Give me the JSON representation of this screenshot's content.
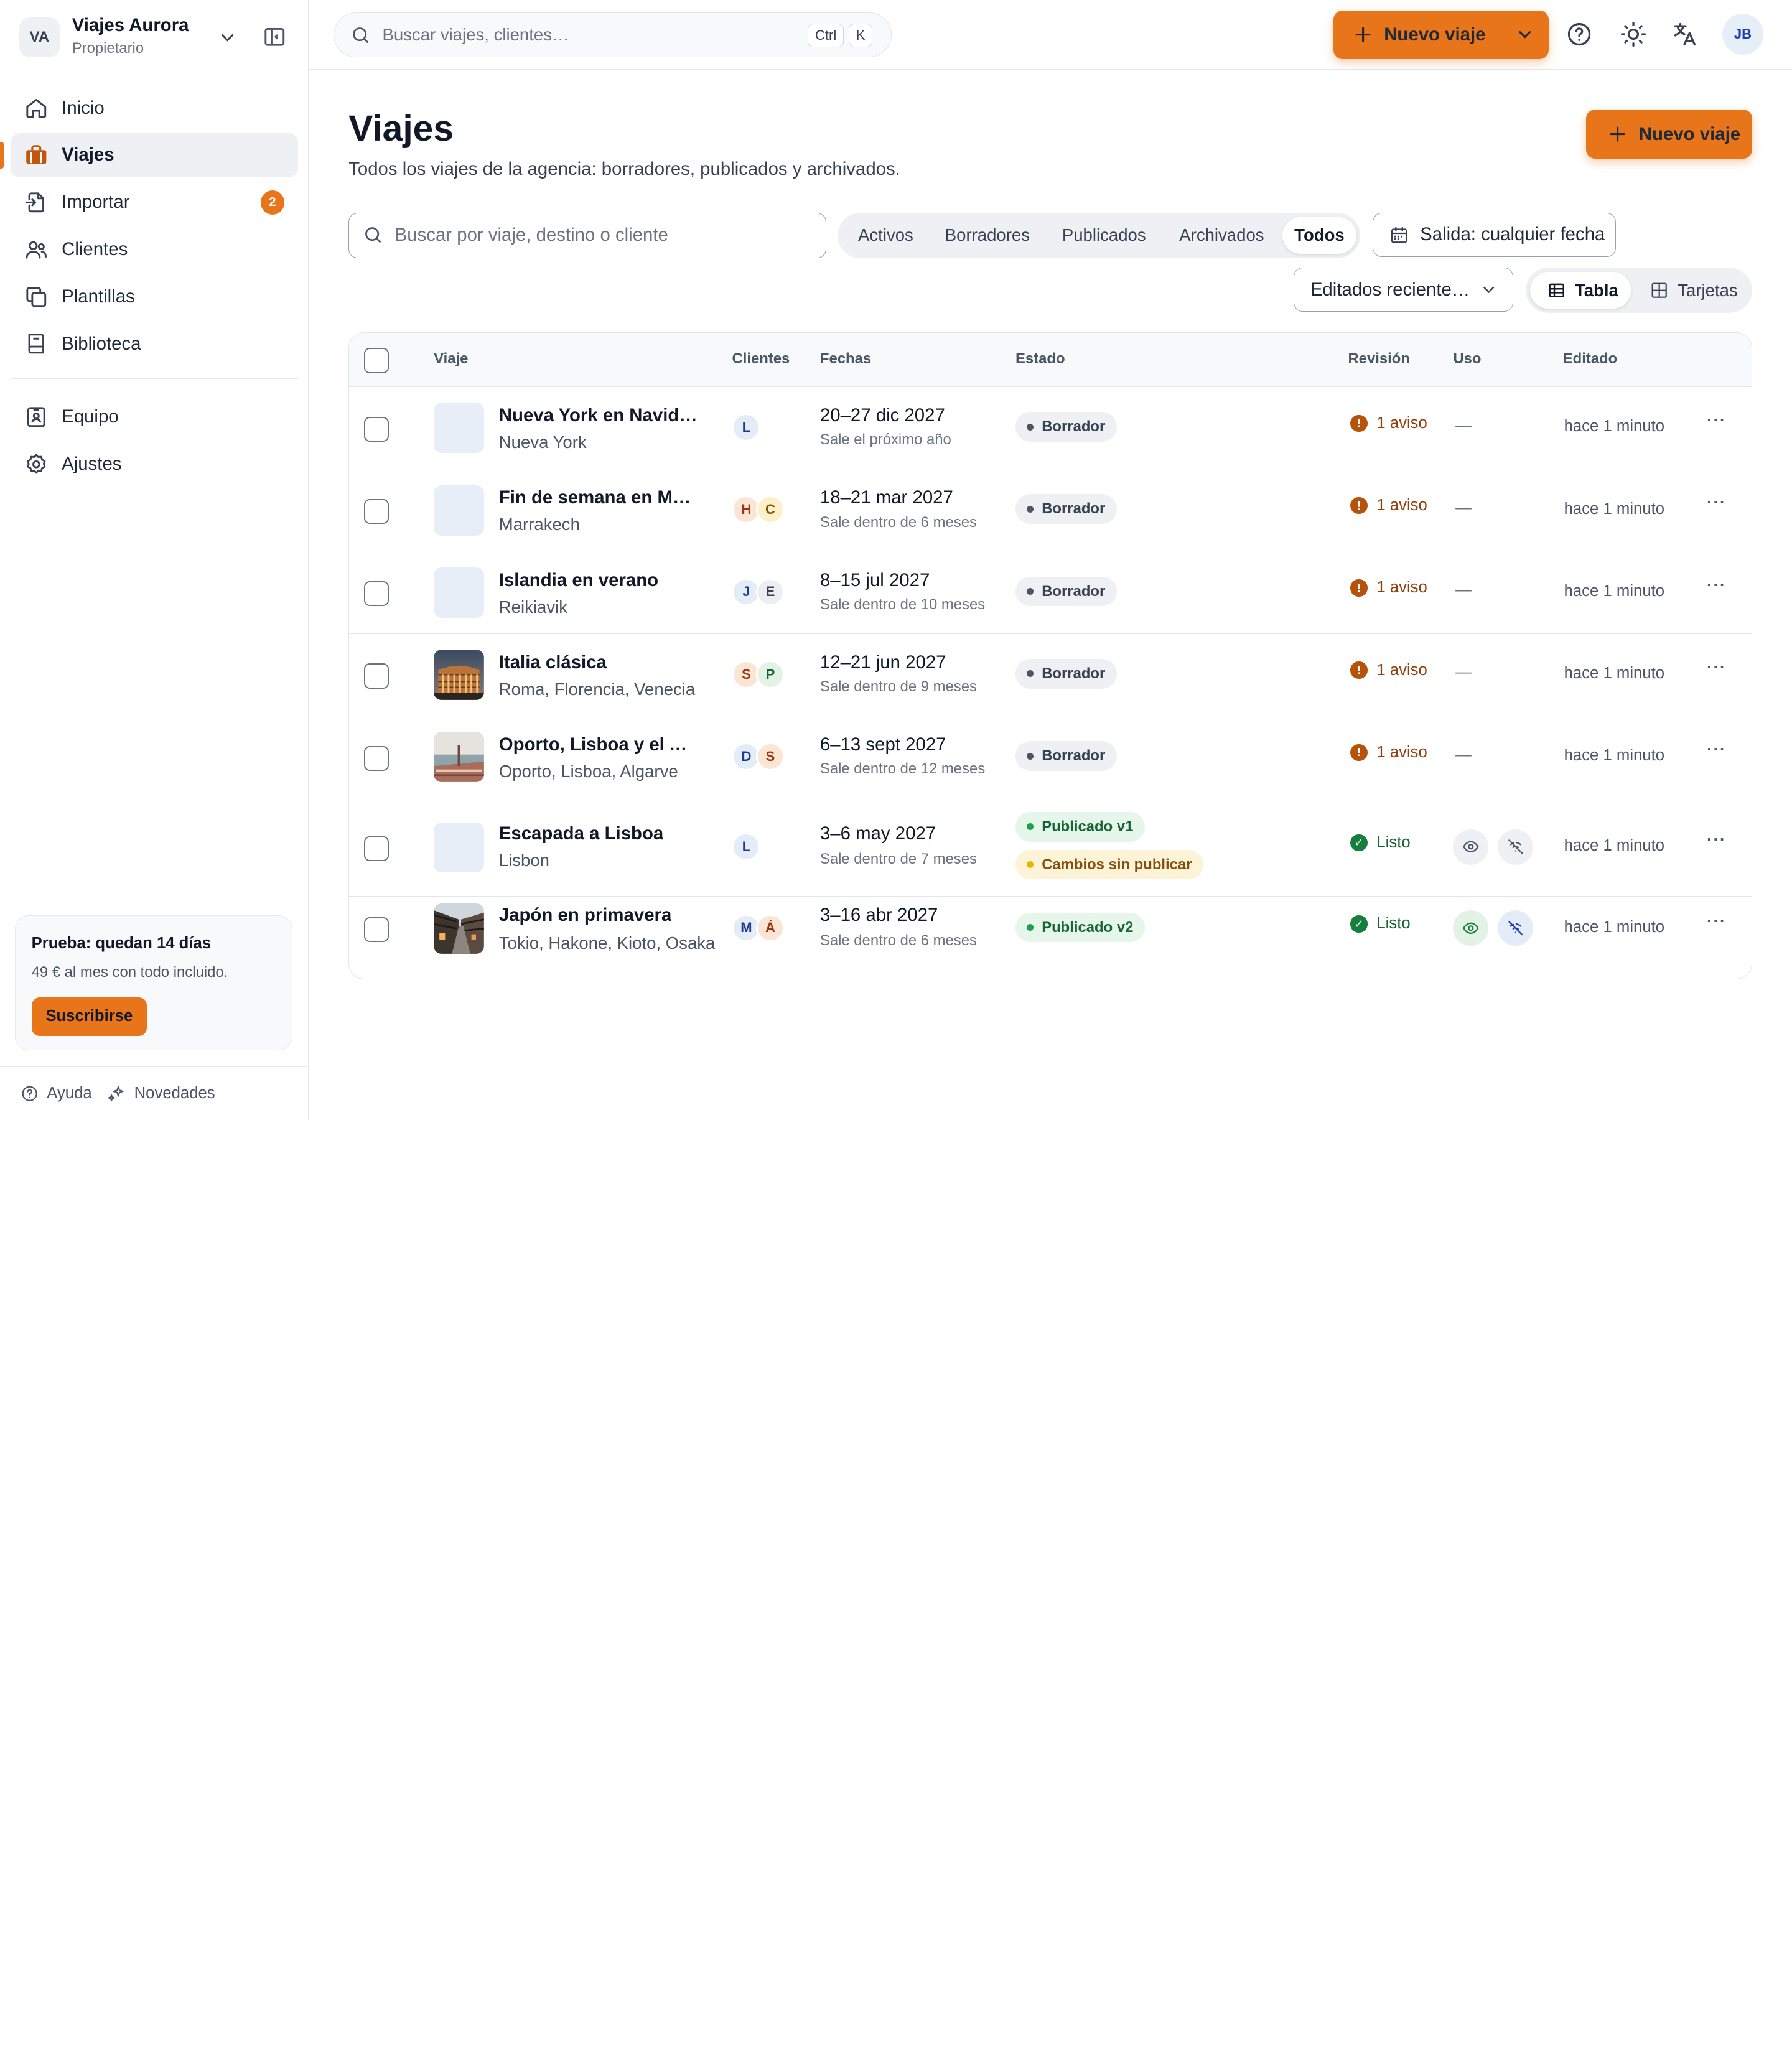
{
  "colors": {
    "accent": "#e8751a",
    "warn": "#b45309",
    "ok": "#15803d"
  },
  "org": {
    "initials": "VA",
    "name": "Viajes Aurora",
    "role": "Propietario"
  },
  "nav": {
    "items": [
      {
        "label": "Inicio",
        "icon": "home-icon"
      },
      {
        "label": "Viajes",
        "icon": "briefcase-icon",
        "active": true
      },
      {
        "label": "Importar",
        "icon": "import-icon",
        "badge": "2"
      },
      {
        "label": "Clientes",
        "icon": "users-icon"
      },
      {
        "label": "Plantillas",
        "icon": "templates-icon"
      },
      {
        "label": "Biblioteca",
        "icon": "book-icon"
      }
    ],
    "secondary": [
      {
        "label": "Equipo",
        "icon": "team-badge-icon"
      },
      {
        "label": "Ajustes",
        "icon": "gear-icon"
      }
    ]
  },
  "trial": {
    "title": "Prueba: quedan 14 días",
    "subtitle": "49 € al mes con todo incluido.",
    "button": "Suscribirse"
  },
  "footer": {
    "help": "Ayuda",
    "news": "Novedades"
  },
  "topbar": {
    "search_placeholder": "Buscar viajes, clientes…",
    "kbd_ctrl": "Ctrl",
    "kbd_k": "K",
    "new_trip": "Nuevo viaje",
    "user_initials": "JB"
  },
  "page": {
    "title": "Viajes",
    "subtitle": "Todos los viajes de la agencia: borradores, publicados y archivados.",
    "new_trip": "Nuevo viaje"
  },
  "filters": {
    "search_placeholder": "Buscar por viaje, destino o cliente",
    "tabs": [
      "Activos",
      "Borradores",
      "Publicados",
      "Archivados",
      "Todos"
    ],
    "active_tab": "Todos",
    "date": "Salida: cualquier fecha",
    "sort": "Editados reciente…",
    "views": [
      "Tabla",
      "Tarjetas"
    ],
    "active_view": "Tabla"
  },
  "table": {
    "columns": [
      "Viaje",
      "Clientes",
      "Fechas",
      "Estado",
      "Revisión",
      "Uso",
      "Editado"
    ],
    "rows": [
      {
        "name": "Nueva York en Navidad",
        "dest": "Nueva York",
        "clients": [
          "L"
        ],
        "dates": "20–27 dic 2027",
        "departs": "Sale el próximo año",
        "status": [
          {
            "label": "Borrador",
            "tone": "gray"
          }
        ],
        "review": "1 aviso",
        "review_tone": "warn",
        "uso": "—",
        "edited": "hace 1 minuto",
        "thumb": "none"
      },
      {
        "name": "Fin de semana en Marr…",
        "dest": "Marrakech",
        "clients": [
          "H",
          "C"
        ],
        "dates": "18–21 mar 2027",
        "departs": "Sale dentro de 6 meses",
        "status": [
          {
            "label": "Borrador",
            "tone": "gray"
          }
        ],
        "review": "1 aviso",
        "review_tone": "warn",
        "uso": "—",
        "edited": "hace 1 minuto",
        "thumb": "none"
      },
      {
        "name": "Islandia en verano",
        "dest": "Reikiavik",
        "clients": [
          "J",
          "E"
        ],
        "dates": "8–15 jul 2027",
        "departs": "Sale dentro de 10 meses",
        "status": [
          {
            "label": "Borrador",
            "tone": "gray"
          }
        ],
        "review": "1 aviso",
        "review_tone": "warn",
        "uso": "—",
        "edited": "hace 1 minuto",
        "thumb": "none"
      },
      {
        "name": "Italia clásica",
        "dest": "Roma, Florencia, Venecia",
        "clients": [
          "S",
          "P"
        ],
        "dates": "12–21 jun 2027",
        "departs": "Sale dentro de 9 meses",
        "status": [
          {
            "label": "Borrador",
            "tone": "gray"
          }
        ],
        "review": "1 aviso",
        "review_tone": "warn",
        "uso": "—",
        "edited": "hace 1 minuto",
        "thumb": "colosseum"
      },
      {
        "name": "Oporto, Lisboa y el Alg…",
        "dest": "Oporto, Lisboa, Algarve",
        "clients": [
          "D",
          "S"
        ],
        "dates": "6–13 sept 2027",
        "departs": "Sale dentro de 12 meses",
        "status": [
          {
            "label": "Borrador",
            "tone": "gray"
          }
        ],
        "review": "1 aviso",
        "review_tone": "warn",
        "uso": "—",
        "edited": "hace 1 minuto",
        "thumb": "coast"
      },
      {
        "name": "Escapada a Lisboa",
        "dest": "Lisbon",
        "clients": [
          "L"
        ],
        "dates": "3–6 may 2027",
        "departs": "Sale dentro de 7 meses",
        "status": [
          {
            "label": "Publicado v1",
            "tone": "green"
          },
          {
            "label": "Cambios sin publicar",
            "tone": "yellow"
          }
        ],
        "review": "Listo",
        "review_tone": "ok",
        "uso": "icons",
        "edited": "hace 1 minuto",
        "thumb": "none"
      },
      {
        "name": "Japón en primavera",
        "dest": "Tokio, Hakone, Kioto, Osaka",
        "clients": [
          "M",
          "Á"
        ],
        "dates": "3–16 abr 2027",
        "departs": "Sale dentro de 6 meses",
        "status": [
          {
            "label": "Publicado v2",
            "tone": "green"
          }
        ],
        "review": "Listo",
        "review_tone": "ok",
        "uso": "icons-active",
        "edited": "hace 1 minuto",
        "thumb": "street"
      }
    ]
  }
}
